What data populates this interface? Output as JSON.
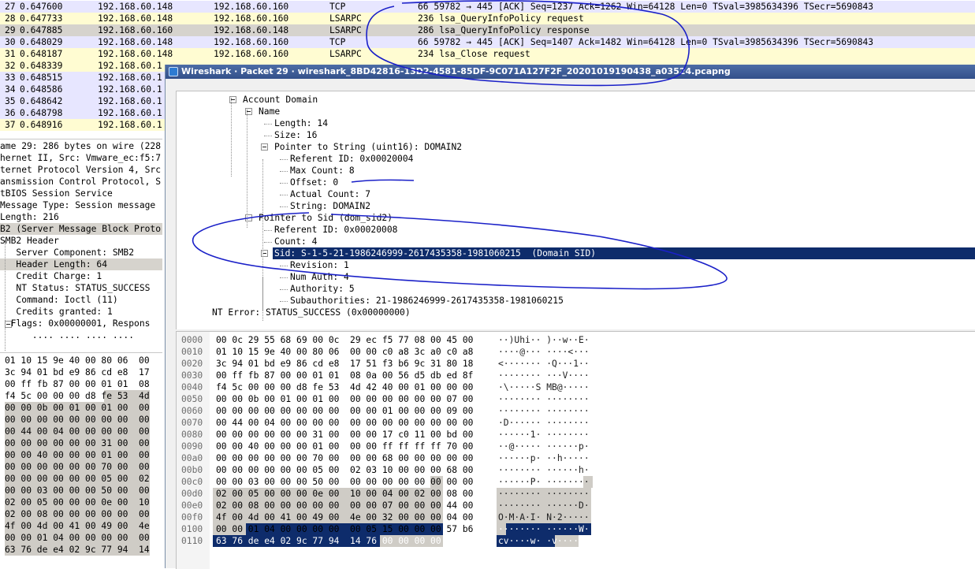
{
  "packet_list": {
    "rows": [
      {
        "no": "27",
        "time": "0.647600",
        "src": "192.168.60.148",
        "dst": "192.168.60.160",
        "proto": "TCP",
        "info": "66 59782 → 445 [ACK] Seq=1237 Ack=1262 Win=64128 Len=0 TSval=3985634396 TSecr=5690843",
        "bg": "#e7e6ff"
      },
      {
        "no": "28",
        "time": "0.647733",
        "src": "192.168.60.148",
        "dst": "192.168.60.160",
        "proto": "LSARPC",
        "info": "236 lsa_QueryInfoPolicy request",
        "bg": "#fffcd2"
      },
      {
        "no": "29",
        "time": "0.647885",
        "src": "192.168.60.160",
        "dst": "192.168.60.148",
        "proto": "LSARPC",
        "info": "286 lsa_QueryInfoPolicy response",
        "bg": "#d6d3cd"
      },
      {
        "no": "30",
        "time": "0.648029",
        "src": "192.168.60.148",
        "dst": "192.168.60.160",
        "proto": "TCP",
        "info": "66 59782 → 445 [ACK] Seq=1407 Ack=1482 Win=64128 Len=0 TSval=3985634396 TSecr=5690843",
        "bg": "#e7e6ff"
      },
      {
        "no": "31",
        "time": "0.648187",
        "src": "192.168.60.148",
        "dst": "192.168.60.160",
        "proto": "LSARPC",
        "info": "234 lsa_Close request",
        "bg": "#fffcd2"
      },
      {
        "no": "32",
        "time": "0.648339",
        "src": "192.168.60.1",
        "dst": "",
        "proto": "",
        "info": "",
        "bg": "#fffcd2"
      },
      {
        "no": "33",
        "time": "0.648515",
        "src": "192.168.60.1",
        "dst": "",
        "proto": "",
        "info": "",
        "bg": "#e7e6ff"
      },
      {
        "no": "34",
        "time": "0.648586",
        "src": "192.168.60.1",
        "dst": "",
        "proto": "",
        "info": "",
        "bg": "#e7e6ff"
      },
      {
        "no": "35",
        "time": "0.648642",
        "src": "192.168.60.1",
        "dst": "",
        "proto": "",
        "info": "",
        "bg": "#e7e6ff"
      },
      {
        "no": "36",
        "time": "0.648798",
        "src": "192.168.60.1",
        "dst": "",
        "proto": "",
        "info": "",
        "bg": "#e7e6ff"
      },
      {
        "no": "37",
        "time": "0.648916",
        "src": "192.168.60.1",
        "dst": "",
        "proto": "",
        "info": "",
        "bg": "#fffcd2"
      }
    ]
  },
  "left_tree": {
    "rows": [
      {
        "text": "ame 29: 286 bytes on wire (228",
        "hl": false
      },
      {
        "text": "hernet II, Src: Vmware_ec:f5:7",
        "hl": false
      },
      {
        "text": "ternet Protocol Version 4, Src",
        "hl": false
      },
      {
        "text": "ansmission Control Protocol, S",
        "hl": false
      },
      {
        "text": "tBIOS Session Service",
        "hl": false
      },
      {
        "text": "Message Type: Session message",
        "hl": false
      },
      {
        "text": "Length: 216",
        "hl": false
      },
      {
        "text": "B2 (Server Message Block Proto",
        "hl": true
      },
      {
        "text": "SMB2 Header",
        "hl": false
      },
      {
        "text": "   Server Component: SMB2",
        "hl": false
      },
      {
        "text": "   Header Length: 64",
        "hl": true
      },
      {
        "text": "   Credit Charge: 1",
        "hl": false
      },
      {
        "text": "   NT Status: STATUS_SUCCESS",
        "hl": false
      },
      {
        "text": "   Command: Ioctl (11)",
        "hl": false
      },
      {
        "text": "   Credits granted: 1",
        "hl": false
      },
      {
        "text": "  Flags: 0x00000001, Respons",
        "hl": false
      },
      {
        "text": "      .... .... .... ....",
        "hl": false
      }
    ]
  },
  "left_hex": {
    "rows": [
      {
        "text": "01 10 15 9e 40 00 80 06  00",
        "hl": false
      },
      {
        "text": "3c 94 01 bd e9 86 cd e8  17",
        "hl": false
      },
      {
        "text": "00 ff fb 87 00 00 01 01  08",
        "hl": false
      },
      {
        "text": "f4 5c 00 00 00 d8 fe 53  4d",
        "hl": "part"
      },
      {
        "text": "00 00 0b 00 01 00 01 00  00",
        "hl": true
      },
      {
        "text": "00 00 00 00 00 00 00 00  00",
        "hl": true
      },
      {
        "text": "00 44 00 04 00 00 00 00  00",
        "hl": true
      },
      {
        "text": "00 00 00 00 00 00 31 00  00",
        "hl": true
      },
      {
        "text": "00 00 40 00 00 00 01 00  00",
        "hl": true
      },
      {
        "text": "00 00 00 00 00 00 70 00  00",
        "hl": true
      },
      {
        "text": "00 00 00 00 00 00 05 00  02",
        "hl": true
      },
      {
        "text": "00 00 03 00 00 00 50 00  00",
        "hl": true
      },
      {
        "text": "02 00 05 00 00 00 0e 00  10",
        "hl": true
      },
      {
        "text": "02 00 08 00 00 00 00 00  00",
        "hl": true
      },
      {
        "text": "4f 00 4d 00 41 00 49 00  4e",
        "hl": true
      },
      {
        "text": "00 00 01 04 00 00 00 00  00",
        "hl": true
      },
      {
        "text": "63 76 de e4 02 9c 77 94  14",
        "hl": true
      }
    ]
  },
  "popup": {
    "title": "Wireshark · Packet 29 · wireshark_8BD42816-13D2-4581-85DF-9C071A127F2F_20201019190438_a03524.pcapng"
  },
  "detail_tree": [
    {
      "text": "Account Domain",
      "level": 0,
      "expander": true,
      "selected": false
    },
    {
      "text": "Name",
      "level": 1,
      "expander": true,
      "selected": false
    },
    {
      "text": "Length: 14",
      "level": 2,
      "expander": false,
      "selected": false
    },
    {
      "text": "Size: 16",
      "level": 2,
      "expander": false,
      "selected": false
    },
    {
      "text": "Pointer to String (uint16): DOMAIN2",
      "level": 2,
      "expander": true,
      "selected": false
    },
    {
      "text": "Referent ID: 0x00020004",
      "level": 3,
      "expander": false,
      "selected": false
    },
    {
      "text": "Max Count: 8",
      "level": 3,
      "expander": false,
      "selected": false
    },
    {
      "text": "Offset: 0",
      "level": 3,
      "expander": false,
      "selected": false
    },
    {
      "text": "Actual Count: 7",
      "level": 3,
      "expander": false,
      "selected": false
    },
    {
      "text": "String: DOMAIN2",
      "level": 3,
      "expander": false,
      "selected": false
    },
    {
      "text": "Pointer to Sid (dom_sid2)",
      "level": 1,
      "expander": true,
      "selected": false
    },
    {
      "text": "Referent ID: 0x00020008",
      "level": 2,
      "expander": false,
      "selected": false
    },
    {
      "text": "Count: 4",
      "level": 2,
      "expander": false,
      "selected": false
    },
    {
      "text": "Sid: S-1-5-21-1986246999-2617435358-1981060215  (Domain SID)",
      "level": 2,
      "expander": true,
      "selected": true
    },
    {
      "text": "Revision: 1",
      "level": 3,
      "expander": false,
      "selected": false
    },
    {
      "text": "Num Auth: 4",
      "level": 3,
      "expander": false,
      "selected": false
    },
    {
      "text": "Authority: 5",
      "level": 3,
      "expander": false,
      "selected": false
    },
    {
      "text": "Subauthorities: 21-1986246999-2617435358-1981060215",
      "level": 3,
      "expander": false,
      "selected": false
    },
    {
      "text": "NT Error: STATUS_SUCCESS (0x00000000)",
      "level": -1,
      "expander": false,
      "selected": false
    }
  ],
  "hex": {
    "rows": [
      {
        "off": "0000",
        "bytes": "00 0c 29 55 68 69 00 0c  29 ec f5 77 08 00 45 00",
        "ascii": "··)Uhi·· )··w··E·"
      },
      {
        "off": "0010",
        "bytes": "01 10 15 9e 40 00 80 06  00 00 c0 a8 3c a0 c0 a8",
        "ascii": "····@··· ····<···"
      },
      {
        "off": "0020",
        "bytes": "3c 94 01 bd e9 86 cd e8  17 51 f3 b6 9c 31 80 18",
        "ascii": "<······· ·Q···1··"
      },
      {
        "off": "0030",
        "bytes": "00 ff fb 87 00 00 01 01  08 0a 00 56 d5 db ed 8f",
        "ascii": "········ ···V····"
      },
      {
        "off": "0040",
        "bytes": "f4 5c 00 00 00 d8 fe 53  4d 42 40 00 01 00 00 00",
        "ascii": "·\\·····S MB@·····"
      },
      {
        "off": "0050",
        "bytes": "00 00 0b 00 01 00 01 00  00 00 00 00 00 00 07 00",
        "ascii": "········ ········"
      },
      {
        "off": "0060",
        "bytes": "00 00 00 00 00 00 00 00  00 00 01 00 00 00 09 00",
        "ascii": "········ ········"
      },
      {
        "off": "0070",
        "bytes": "00 44 00 04 00 00 00 00  00 00 00 00 00 00 00 00",
        "ascii": "·D······ ········"
      },
      {
        "off": "0080",
        "bytes": "00 00 00 00 00 00 31 00  00 00 17 c0 11 00 bd 00",
        "ascii": "······1· ········"
      },
      {
        "off": "0090",
        "bytes": "00 00 40 00 00 00 01 00  00 00 ff ff ff ff 70 00",
        "ascii": "··@····· ······p·"
      },
      {
        "off": "00a0",
        "bytes": "00 00 00 00 00 00 70 00  00 00 68 00 00 00 00 00",
        "ascii": "······p· ··h·····"
      },
      {
        "off": "00b0",
        "bytes": "00 00 00 00 00 00 05 00  02 03 10 00 00 00 68 00",
        "ascii": "········ ······h·"
      },
      {
        "off": "00c0",
        "bytes": "00 00 03 00 00 00 50 00  00 00 00 00 00 00 00 00",
        "ascii": "······P· ········"
      },
      {
        "off": "00d0",
        "bytes": "02 00 05 00 00 00 0e 00  10 00 04 00 02 00 08 00",
        "ascii": "········ ········"
      },
      {
        "off": "00e0",
        "bytes": "02 00 08 00 00 00 00 00  00 00 07 00 00 00 44 00",
        "ascii": "········ ······D·"
      },
      {
        "off": "00f0",
        "bytes": "4f 00 4d 00 41 00 49 00  4e 00 32 00 00 00 04 00",
        "ascii": "O·M·A·I· N·2·····"
      },
      {
        "off": "0100",
        "bytes": "00 00 01 04 00 00 00 00  00 05 15 00 00 00 57 b6",
        "ascii": "········ ······W·"
      },
      {
        "off": "0110",
        "bytes": "63 76 de e4 02 9c 77 94  14 76 00 00 00 00",
        "ascii": "cv····w· ·v····"
      }
    ]
  },
  "colors": {
    "tcp_row": "#e7e6ff",
    "lsarpc_row": "#fffcd2",
    "selected_row": "#d6d3cd",
    "selection_blue": "#0e2c6b",
    "annotation_ink": "#1a20c8"
  }
}
